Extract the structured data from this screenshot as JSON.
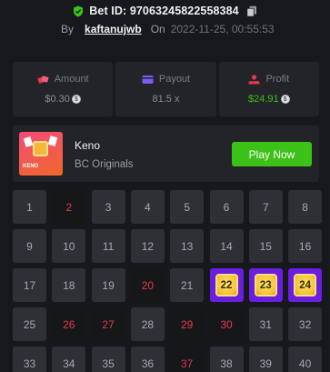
{
  "header": {
    "bet_id": "Bet ID: 97063245822558384",
    "by": "By",
    "username": "kaftanujwb",
    "on": "On",
    "timestamp": "2022-11-25, 00:55:53"
  },
  "stats": {
    "amount": {
      "label": "Amount",
      "value": "$0.30"
    },
    "payout": {
      "label": "Payout",
      "value": "81.5 x"
    },
    "profit": {
      "label": "Profit",
      "value": "$24.91"
    }
  },
  "colors": {
    "accent_green": "#3bc117",
    "hit_purple": "#6a1ee0",
    "miss_red": "#e5384f"
  },
  "game": {
    "name": "Keno",
    "provider": "BC Originals",
    "thumb_label": "KENO",
    "play_label": "Play Now"
  },
  "keno": {
    "cells": [
      {
        "n": "1",
        "state": "normal"
      },
      {
        "n": "2",
        "state": "picked"
      },
      {
        "n": "3",
        "state": "normal"
      },
      {
        "n": "4",
        "state": "normal"
      },
      {
        "n": "5",
        "state": "normal"
      },
      {
        "n": "6",
        "state": "normal"
      },
      {
        "n": "7",
        "state": "normal"
      },
      {
        "n": "8",
        "state": "normal"
      },
      {
        "n": "9",
        "state": "normal"
      },
      {
        "n": "10",
        "state": "normal"
      },
      {
        "n": "11",
        "state": "normal"
      },
      {
        "n": "12",
        "state": "normal"
      },
      {
        "n": "13",
        "state": "normal"
      },
      {
        "n": "14",
        "state": "normal"
      },
      {
        "n": "15",
        "state": "normal"
      },
      {
        "n": "16",
        "state": "normal"
      },
      {
        "n": "17",
        "state": "normal"
      },
      {
        "n": "18",
        "state": "normal"
      },
      {
        "n": "19",
        "state": "normal"
      },
      {
        "n": "20",
        "state": "picked"
      },
      {
        "n": "21",
        "state": "normal"
      },
      {
        "n": "22",
        "state": "hit"
      },
      {
        "n": "23",
        "state": "hit"
      },
      {
        "n": "24",
        "state": "hit"
      },
      {
        "n": "25",
        "state": "normal"
      },
      {
        "n": "26",
        "state": "picked"
      },
      {
        "n": "27",
        "state": "picked"
      },
      {
        "n": "28",
        "state": "normal"
      },
      {
        "n": "29",
        "state": "picked"
      },
      {
        "n": "30",
        "state": "picked"
      },
      {
        "n": "31",
        "state": "normal"
      },
      {
        "n": "32",
        "state": "normal"
      },
      {
        "n": "33",
        "state": "normal"
      },
      {
        "n": "34",
        "state": "normal"
      },
      {
        "n": "35",
        "state": "normal"
      },
      {
        "n": "36",
        "state": "normal"
      },
      {
        "n": "37",
        "state": "picked"
      },
      {
        "n": "38",
        "state": "normal"
      },
      {
        "n": "39",
        "state": "normal"
      },
      {
        "n": "40",
        "state": "normal"
      }
    ]
  }
}
